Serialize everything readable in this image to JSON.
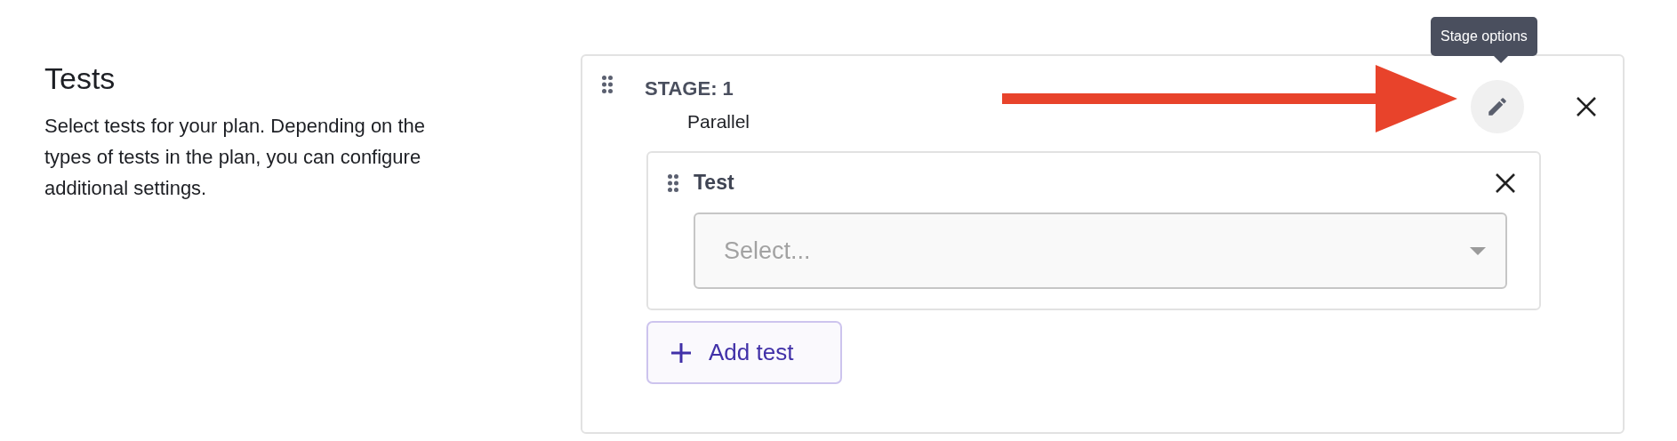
{
  "section": {
    "title": "Tests",
    "description": "Select tests for your plan. Depending on the types of tests in the plan, you can configure additional settings."
  },
  "stage": {
    "title": "STAGE: 1",
    "mode": "Parallel",
    "options_tooltip": "Stage options",
    "tests": [
      {
        "label": "Test",
        "select": {
          "placeholder": "Select..."
        }
      }
    ],
    "add_button": "Add test"
  }
}
